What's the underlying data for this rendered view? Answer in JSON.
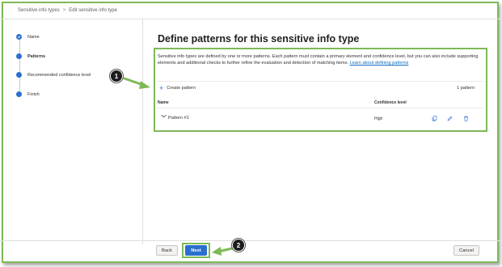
{
  "breadcrumb": {
    "items": [
      "Sensitive info types",
      "Edit sensitive info type"
    ],
    "separator": ">"
  },
  "stepper": {
    "steps": [
      {
        "label": "Name",
        "state": "completed"
      },
      {
        "label": "Patterns",
        "state": "current"
      },
      {
        "label": "Recommended confidence level",
        "state": "pending"
      },
      {
        "label": "Finish",
        "state": "pending"
      }
    ]
  },
  "main": {
    "title": "Define patterns for this sensitive info type",
    "description": "Sensitive info types are defined by one or more patterns. Each pattern must contain a primary element and confidence level, but you can also include supporting elements and additional checks to further refine the evaluation and detection of matching items.",
    "learn_more_link": "Learn about defining patterns",
    "create_pattern_label": "Create pattern",
    "pattern_count": "1 pattern",
    "table": {
      "columns": [
        "Name",
        "Confidence level"
      ],
      "rows": [
        {
          "name": "Pattern #1",
          "confidence": "High"
        }
      ]
    }
  },
  "callouts": {
    "one": "1",
    "two": "2"
  },
  "footer": {
    "back_label": "Back",
    "next_label": "Next",
    "cancel_label": "Cancel"
  },
  "colors": {
    "accent": "#2b6fce",
    "highlight": "#7dba57"
  }
}
